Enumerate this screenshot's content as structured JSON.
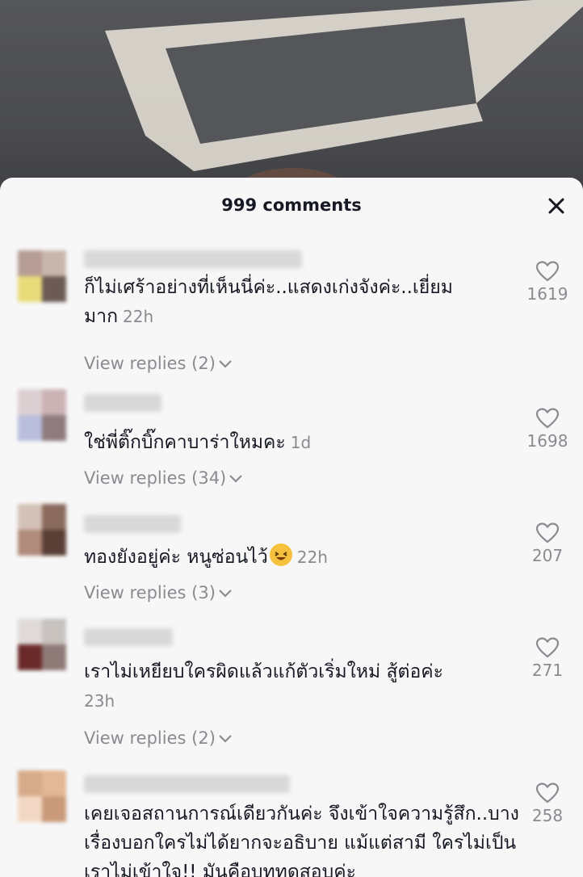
{
  "header": {
    "comment_count": "999 comments",
    "close_icon": "close-icon"
  },
  "comments": [
    {
      "text": "ก็ไม่เศร้าอย่างที่เห็นนี่ค่ะ..แสดงเก่งจังค่ะ..เยี่ยมมาก",
      "time": "22h",
      "replies": "View replies (2)",
      "likes": "1619"
    },
    {
      "text": "ใช่พี่ติ๊กบิ๊กคาบาร่าใหมคะ",
      "time": "1d",
      "replies": "View replies (34)",
      "likes": "1698"
    },
    {
      "text": "ทองยังอยู่ค่ะ หนูซ่อนไว้",
      "emoji": "rolling-on-floor-laughing",
      "time": "22h",
      "replies": "View replies (3)",
      "likes": "207"
    },
    {
      "text": "เราไม่เหยียบใครผิดแล้วแก้ตัวเริ่มใหม่ สู้ต่อค่ะ",
      "time": "23h",
      "replies": "View replies (2)",
      "likes": "271"
    },
    {
      "text": "เคยเจอสถานการณ์เดียวกันค่ะ จึงเข้าใจความรู้สึก..บางเรื่องบอกใครไม่ได้ยากจะอธิบาย แม้แต่สามี ใครไม่เป็นเราไม่เข้าใจ!! มันคือบททดสอบค่ะ",
      "likes": "258"
    }
  ],
  "colors": {
    "sheet_bg": "#f7f7f7",
    "text_primary": "#161823",
    "text_secondary": "#8a8b91"
  }
}
